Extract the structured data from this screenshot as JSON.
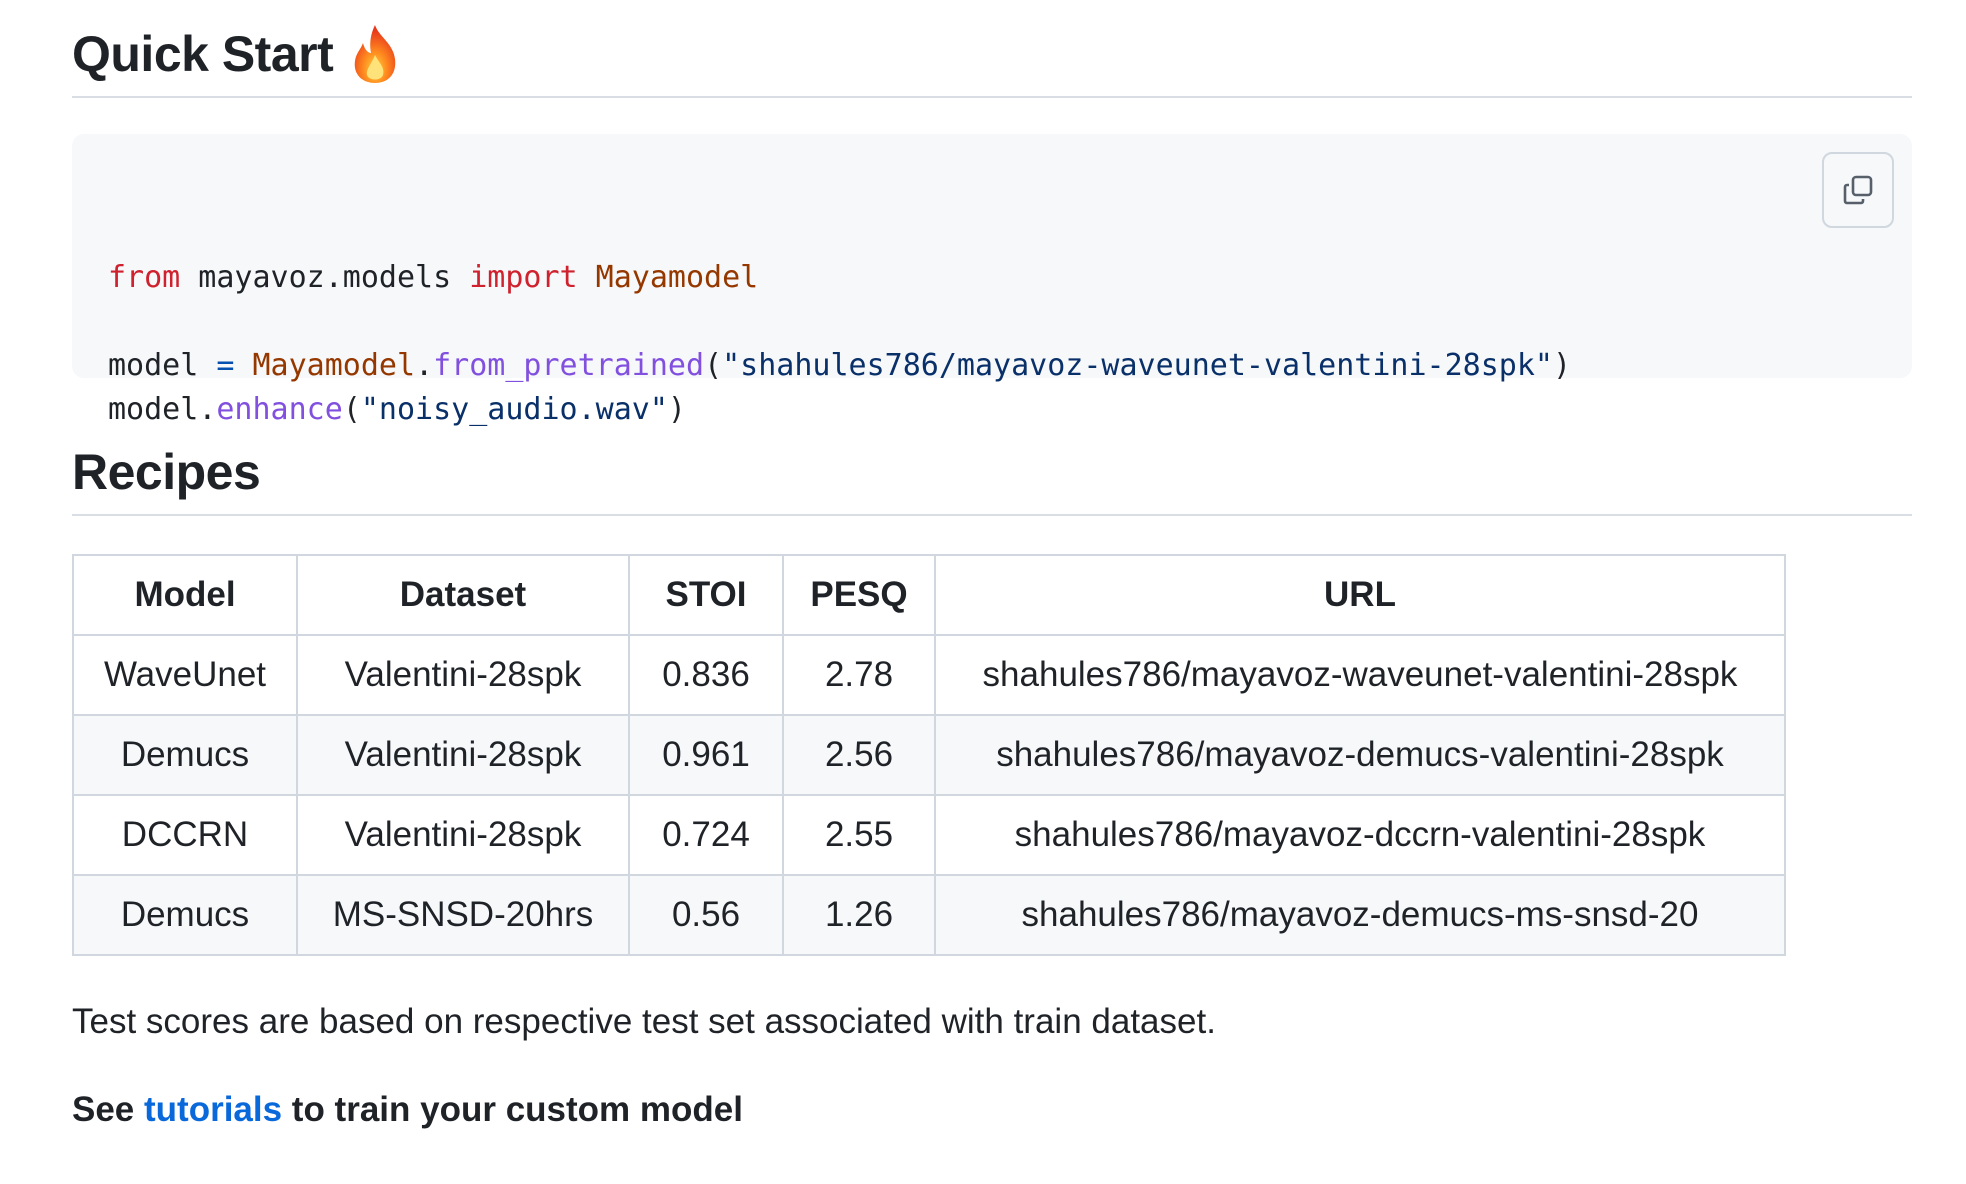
{
  "quick_start": {
    "heading": "Quick Start",
    "emoji_icon": "fire-icon"
  },
  "code": {
    "lines": [
      [
        {
          "t": "from",
          "c": "kw"
        },
        {
          "t": " mayavoz.models ",
          "c": ""
        },
        {
          "t": "import",
          "c": "kw"
        },
        {
          "t": " ",
          "c": ""
        },
        {
          "t": "Mayamodel",
          "c": "cls"
        }
      ],
      [],
      [
        {
          "t": "model ",
          "c": ""
        },
        {
          "t": "=",
          "c": "op"
        },
        {
          "t": " ",
          "c": ""
        },
        {
          "t": "Mayamodel",
          "c": "cls"
        },
        {
          "t": ".",
          "c": ""
        },
        {
          "t": "from_pretrained",
          "c": "fn"
        },
        {
          "t": "(",
          "c": ""
        },
        {
          "t": "\"shahules786/mayavoz-waveunet-valentini-28spk\"",
          "c": "str"
        },
        {
          "t": ")",
          "c": ""
        }
      ],
      [
        {
          "t": "model",
          "c": ""
        },
        {
          "t": ".",
          "c": ""
        },
        {
          "t": "enhance",
          "c": "fn"
        },
        {
          "t": "(",
          "c": ""
        },
        {
          "t": "\"noisy_audio.wav\"",
          "c": "str"
        },
        {
          "t": ")",
          "c": ""
        }
      ]
    ],
    "copy_icon": "copy-icon"
  },
  "recipes": {
    "heading": "Recipes",
    "columns": [
      "Model",
      "Dataset",
      "STOI",
      "PESQ",
      "URL"
    ],
    "rows": [
      [
        "WaveUnet",
        "Valentini-28spk",
        "0.836",
        "2.78",
        "shahules786/mayavoz-waveunet-valentini-28spk"
      ],
      [
        "Demucs",
        "Valentini-28spk",
        "0.961",
        "2.56",
        "shahules786/mayavoz-demucs-valentini-28spk"
      ],
      [
        "DCCRN",
        "Valentini-28spk",
        "0.724",
        "2.55",
        "shahules786/mayavoz-dccrn-valentini-28spk"
      ],
      [
        "Demucs",
        "MS-SNSD-20hrs",
        "0.56",
        "1.26",
        "shahules786/mayavoz-demucs-ms-snsd-20"
      ]
    ]
  },
  "note": "Test scores are based on respective test set associated with train dataset.",
  "see": {
    "prefix": "See ",
    "link": "tutorials",
    "suffix": " to train your custom model"
  }
}
